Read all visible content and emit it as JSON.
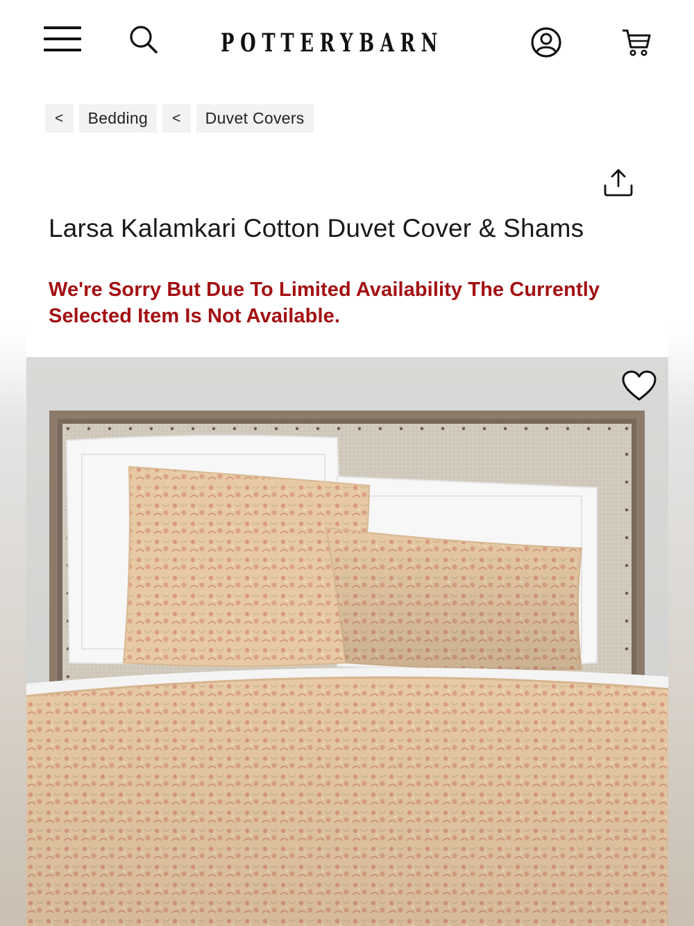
{
  "header": {
    "logo_text": "POTTERYBARN",
    "icons": [
      "menu-icon",
      "search-icon",
      "account-icon",
      "cart-icon"
    ]
  },
  "breadcrumb": {
    "items": [
      {
        "chevron": "<",
        "label": "Bedding"
      },
      {
        "chevron": "<",
        "label": "Duvet Covers"
      }
    ]
  },
  "product": {
    "title": "Larsa Kalamkari Cotton Duvet Cover & Shams",
    "availability_message": "We're Sorry But Due To Limited Availability The Currently Selected Item Is Not Available.",
    "share_icon": "share-icon",
    "favorite_icon": "heart-icon"
  },
  "colors": {
    "alert": "#a30f12",
    "text": "#1a1a1a",
    "breadcrumb_bg": "#f2f2f2"
  }
}
